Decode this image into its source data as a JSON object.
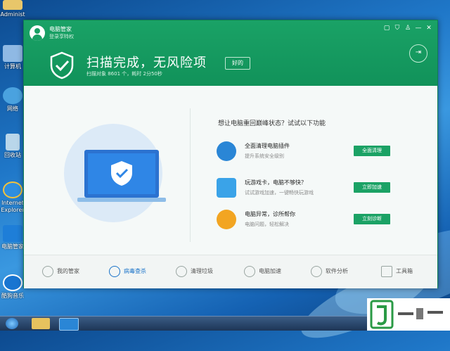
{
  "desktop": {
    "icons": [
      {
        "label": "Administ",
        "icon": "user-folder-icon"
      },
      {
        "label": "计算机",
        "icon": "computer-icon"
      },
      {
        "label": "网络",
        "icon": "network-icon"
      },
      {
        "label": "回收站",
        "icon": "recycle-bin-icon"
      },
      {
        "label": "Internet Explorer",
        "icon": "ie-icon"
      },
      {
        "label": "电脑管家",
        "icon": "pc-manager-icon"
      },
      {
        "label": "酷狗音乐",
        "icon": "kugou-music-icon"
      }
    ]
  },
  "window": {
    "brand": "电脑管家",
    "login_prompt": "登录享特权",
    "controls": [
      "屏",
      "盾",
      "衣",
      "—",
      "✕"
    ],
    "title": "扫描完成，无风险项",
    "ok_label": "好的",
    "stats": "扫描对象 8601 个，耗时 2分50秒",
    "exit_icon": "exit-icon"
  },
  "main": {
    "prompt": "想让电脑重回巅峰状态？试试以下功能",
    "features": [
      {
        "title": "全面清理电脑插件",
        "subtitle": "提升系统安全级别",
        "button": "全面清理",
        "icon": "puzzle-icon",
        "color": "#2a86d6"
      },
      {
        "title": "玩游戏卡，电脑不够快？",
        "subtitle": "试试游戏加速，一键畅快玩游戏",
        "button": "立即加速",
        "icon": "rocket-icon",
        "color": "#3aa3e8"
      },
      {
        "title": "电脑异常，诊所帮你",
        "subtitle": "电脑问题，轻松解决",
        "button": "立刻诊断",
        "icon": "stethoscope-icon",
        "color": "#f2a522"
      }
    ]
  },
  "nav": {
    "items": [
      {
        "label": "我的管家",
        "icon": "manager-icon",
        "active": false
      },
      {
        "label": "病毒查杀",
        "icon": "virus-scan-icon",
        "active": true
      },
      {
        "label": "清理垃圾",
        "icon": "cleanup-icon",
        "active": false
      },
      {
        "label": "电脑加速",
        "icon": "speedup-icon",
        "active": false
      },
      {
        "label": "软件分析",
        "icon": "software-icon",
        "active": false
      },
      {
        "label": "工具箱",
        "icon": "toolbox-icon",
        "active": false
      }
    ]
  },
  "colors": {
    "brand_green": "#18a064",
    "accent_blue": "#1a73c9"
  }
}
